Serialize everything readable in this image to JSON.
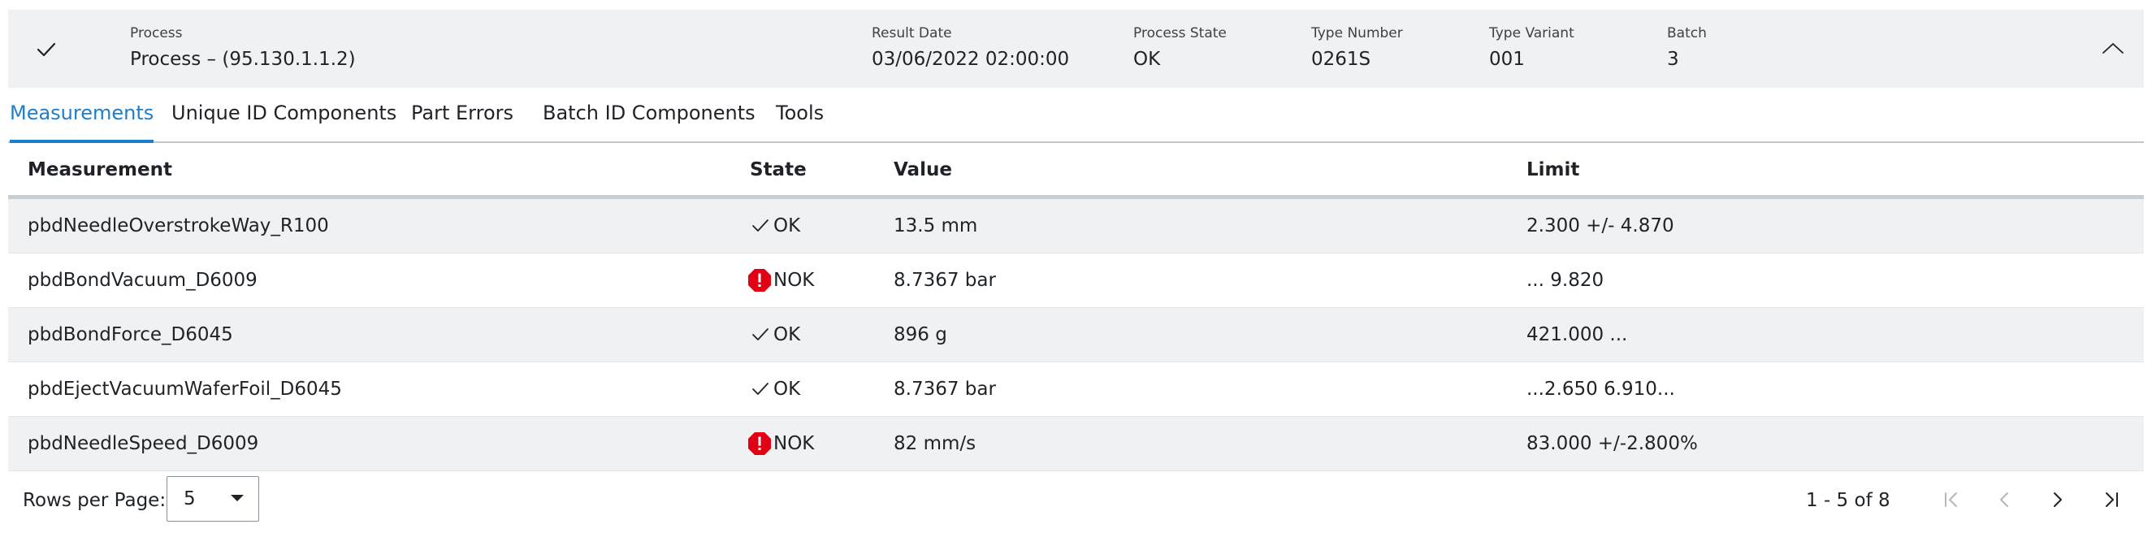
{
  "header": {
    "status_icon": "checkmark-icon",
    "fields": [
      {
        "label": "Process",
        "value": "Process – (95.130.1.1.2)"
      },
      {
        "label": "Result Date",
        "value": "03/06/2022 02:00:00"
      },
      {
        "label": "Process State",
        "value": "OK"
      },
      {
        "label": "Type Number",
        "value": "0261S"
      },
      {
        "label": "Type Variant",
        "value": "001"
      },
      {
        "label": "Batch",
        "value": "3"
      }
    ],
    "collapse_icon": "chevron-up-icon"
  },
  "tabs": [
    {
      "label": "Measurements",
      "active": true
    },
    {
      "label": "Unique ID Components",
      "active": false
    },
    {
      "label": "Part Errors",
      "active": false
    },
    {
      "label": "Batch ID Components",
      "active": false
    },
    {
      "label": "Tools",
      "active": false
    }
  ],
  "table": {
    "columns": [
      "Measurement",
      "State",
      "Value",
      "Limit"
    ],
    "rows": [
      {
        "measurement": "pbdNeedleOverstrokeWay_R100",
        "state": "OK",
        "value": "13.5 mm",
        "limit": "2.300 +/- 4.870"
      },
      {
        "measurement": "pbdBondVacuum_D6009",
        "state": "NOK",
        "value": "8.7367 bar",
        "limit": "... 9.820"
      },
      {
        "measurement": "pbdBondForce_D6045",
        "state": "OK",
        "value": "896 g",
        "limit": "421.000 ..."
      },
      {
        "measurement": "pbdEjectVacuumWaferFoil_D6045",
        "state": "OK",
        "value": "8.7367 bar",
        "limit": "...2.650 6.910..."
      },
      {
        "measurement": "pbdNeedleSpeed_D6009",
        "state": "NOK",
        "value": "82 mm/s",
        "limit": "83.000 +/-2.800%"
      }
    ]
  },
  "footer": {
    "rows_per_page_label": "Rows per Page:",
    "rows_per_page_value": "5",
    "page_range": "1 - 5 of 8",
    "nav_icons": [
      "first-page-icon",
      "previous-page-icon",
      "next-page-icon",
      "last-page-icon"
    ]
  },
  "colors": {
    "accent": "#1f7ec9",
    "header_bg": "#eff1f2",
    "nok_red": "#e20015",
    "disabled": "#b3b8bd"
  }
}
